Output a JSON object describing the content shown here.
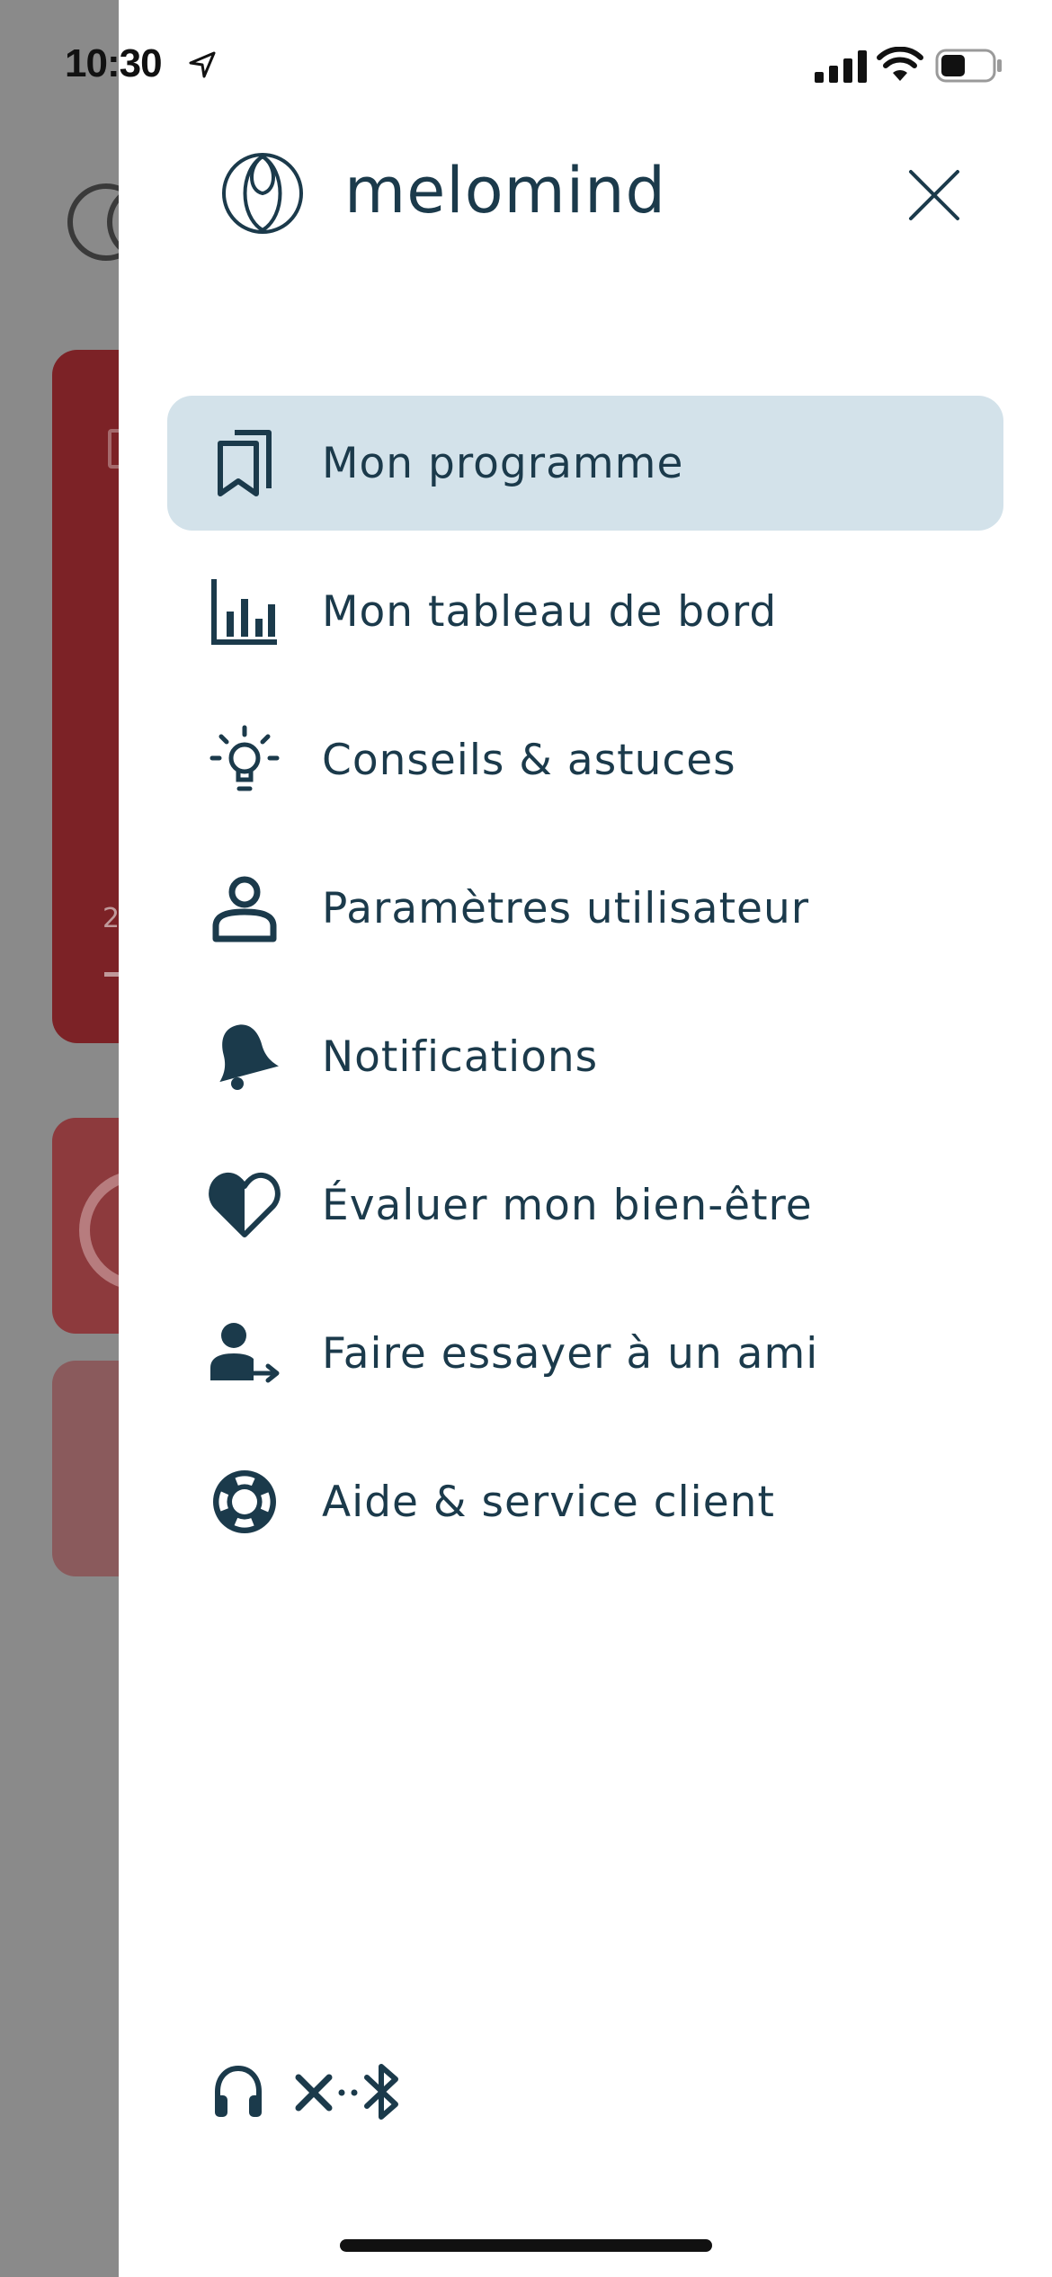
{
  "status_bar": {
    "time": "10:30",
    "battery_level": 0.45,
    "icons": [
      "location-arrow-icon",
      "cellular-signal-icon",
      "wifi-icon",
      "battery-icon"
    ]
  },
  "drawer": {
    "brand": {
      "name": "melomind",
      "logo": "melomind-logo"
    },
    "close_icon": "close-icon",
    "menu": [
      {
        "label": "Mon programme",
        "icon": "bookmark-icon",
        "active": true
      },
      {
        "label": "Mon tableau de bord",
        "icon": "bar-chart-icon",
        "active": false
      },
      {
        "label": "Conseils & astuces",
        "icon": "lightbulb-icon",
        "active": false
      },
      {
        "label": "Paramètres utilisateur",
        "icon": "user-icon",
        "active": false
      },
      {
        "label": "Notifications",
        "icon": "bell-icon",
        "active": false
      },
      {
        "label": "Évaluer mon bien-être",
        "icon": "heart-icon",
        "active": false
      },
      {
        "label": "Faire essayer à un ami",
        "icon": "user-share-icon",
        "active": false
      },
      {
        "label": "Aide & service client",
        "icon": "lifebuoy-icon",
        "active": false
      }
    ],
    "device_status": {
      "headset_icon": "headphones-icon",
      "connection_icon": "bluetooth-disconnected-icon"
    }
  },
  "colors": {
    "text": "#1b3a4b",
    "active_bg": "#d3e2ea",
    "overlay": "#8a8a8a",
    "card_red": "#7c2226"
  }
}
